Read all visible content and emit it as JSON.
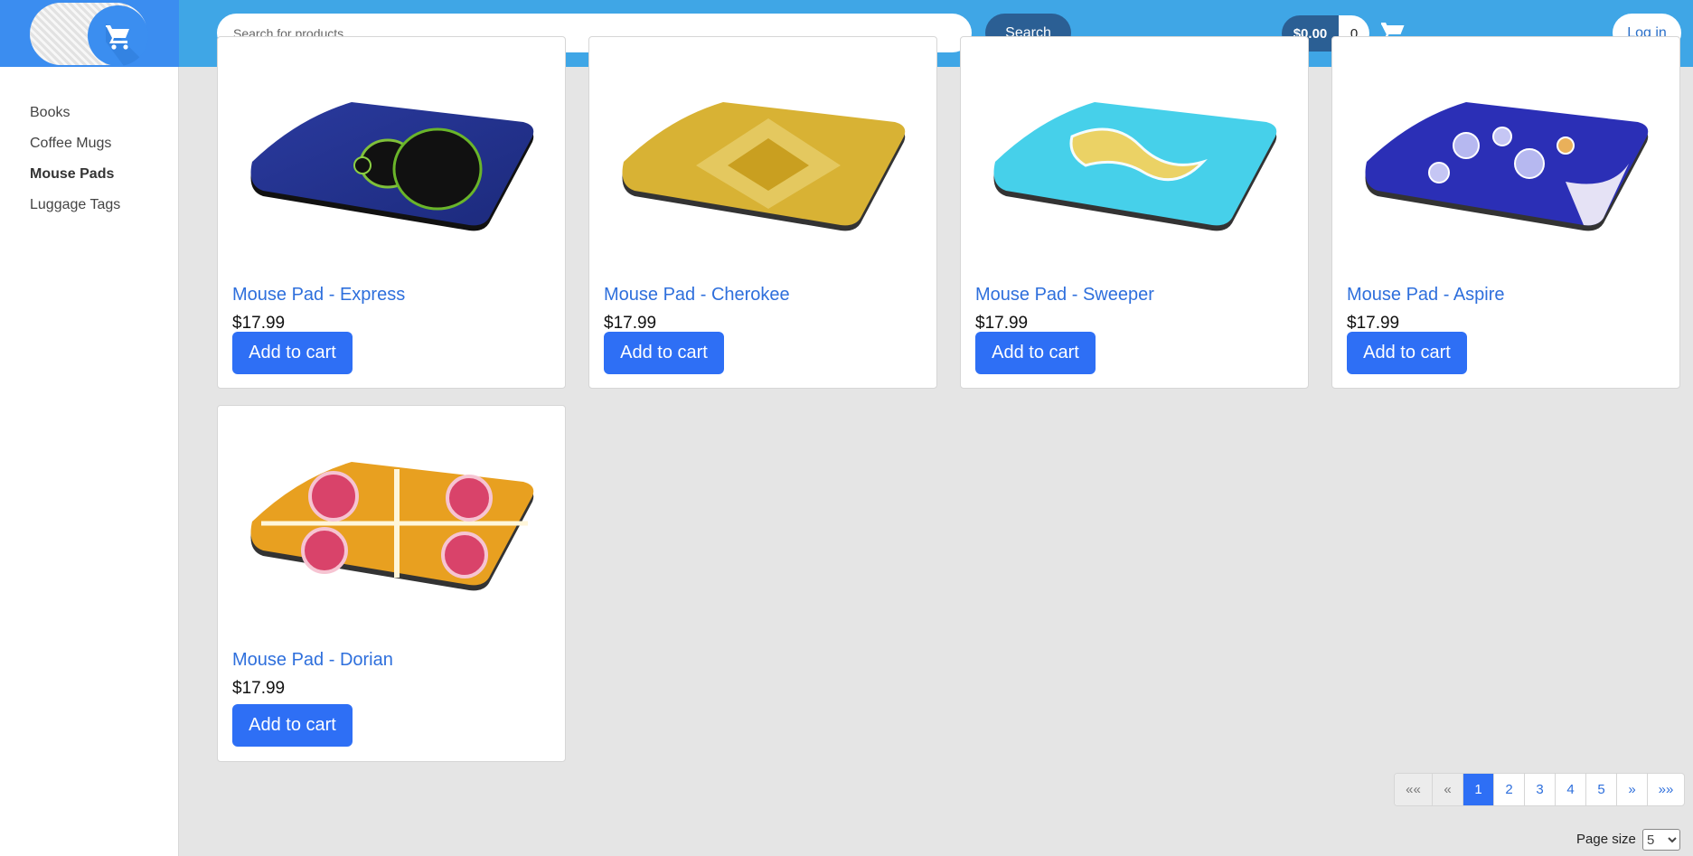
{
  "header": {
    "search_placeholder": "Search for products ...",
    "search_button": "Search",
    "cart_total": "$0.00",
    "cart_count": "0",
    "login_button": "Log in",
    "colors": {
      "bar": "#3fa6e6",
      "dark_button": "#2b5f94",
      "logo_bg": "#3b8df0"
    }
  },
  "sidebar": {
    "items": [
      {
        "label": "Books",
        "active": false
      },
      {
        "label": "Coffee Mugs",
        "active": false
      },
      {
        "label": "Mouse Pads",
        "active": true
      },
      {
        "label": "Luggage Tags",
        "active": false
      }
    ]
  },
  "products": [
    {
      "title": "Mouse Pad - Express",
      "price": "$17.99",
      "button": "Add to cart",
      "art": "mandelbrot-blue-black"
    },
    {
      "title": "Mouse Pad - Cherokee",
      "price": "$17.99",
      "button": "Add to cart",
      "art": "gold-diamond-fractal"
    },
    {
      "title": "Mouse Pad - Sweeper",
      "price": "$17.99",
      "button": "Add to cart",
      "art": "cyan-swirl"
    },
    {
      "title": "Mouse Pad - Aspire",
      "price": "$17.99",
      "button": "Add to cart",
      "art": "blue-bubbles"
    },
    {
      "title": "Mouse Pad - Dorian",
      "price": "$17.99",
      "button": "Add to cart",
      "art": "red-orange-spirals"
    }
  ],
  "pagination": {
    "first": "««",
    "prev": "«",
    "pages": [
      "1",
      "2",
      "3",
      "4",
      "5"
    ],
    "current_page": "1",
    "next": "»",
    "last": "»»"
  },
  "page_size": {
    "label": "Page size",
    "value": "5"
  },
  "colors": {
    "accent": "#2e6ff5",
    "link": "#2e6fdc",
    "page_bg": "#e5e5e5"
  }
}
